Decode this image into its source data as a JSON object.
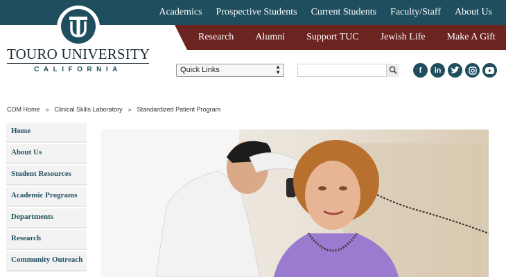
{
  "top_nav": [
    "Academics",
    "Prospective Students",
    "Current Students",
    "Faculty/Staff",
    "About Us"
  ],
  "sub_nav": [
    "Research",
    "Alumni",
    "Support TUC",
    "Jewish Life",
    "Make A Gift"
  ],
  "logo": {
    "name": "TOURO UNIVERSITY",
    "sub": "CALIFORNIA"
  },
  "quick_links": {
    "selected": "Quick Links"
  },
  "search": {
    "placeholder": ""
  },
  "social_icons": [
    "facebook-icon",
    "linkedin-icon",
    "twitter-icon",
    "instagram-icon",
    "youtube-icon"
  ],
  "breadcrumb": [
    "COM Home",
    "Clinical Skills Laboratory",
    "Standardized Patient Program"
  ],
  "breadcrumb_sep": "»",
  "side_menu": [
    "Home",
    "About Us",
    "Student Resources",
    "Academic Programs",
    "Departments",
    "Research",
    "Community Outreach"
  ],
  "colors": {
    "primary": "#1f4e5f",
    "secondary": "#6b2420"
  }
}
